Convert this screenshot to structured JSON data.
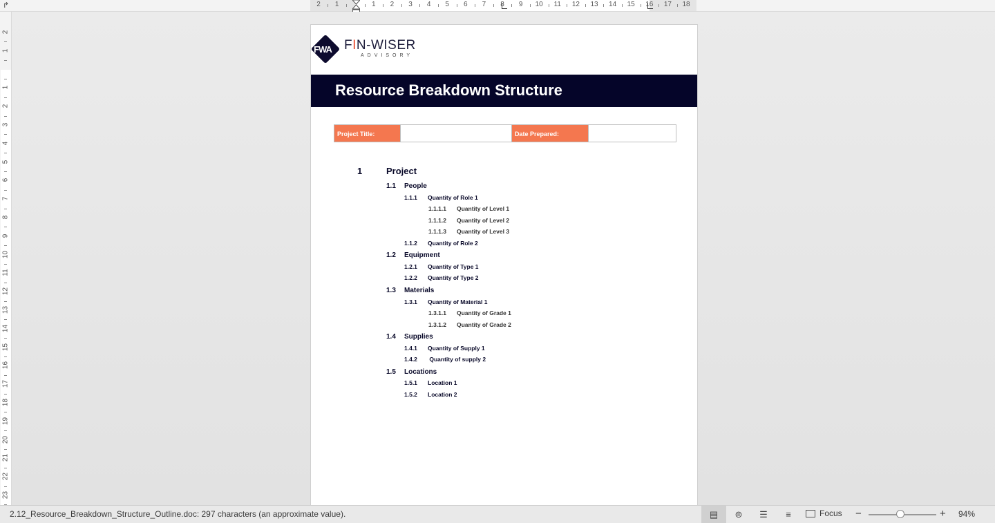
{
  "ruler": {
    "numbers": [
      "2",
      "1",
      "",
      "1",
      "2",
      "3",
      "4",
      "5",
      "6",
      "7",
      "8",
      "9",
      "10",
      "11",
      "12",
      "13",
      "14",
      "15",
      "16",
      "17",
      "18"
    ],
    "vertical_numbers": [
      "2",
      "1",
      "",
      "1",
      "2",
      "3",
      "4",
      "5",
      "6",
      "7",
      "8",
      "9",
      "10",
      "11",
      "12",
      "13",
      "14",
      "15",
      "16",
      "17",
      "18",
      "19",
      "20",
      "21",
      "22",
      "23"
    ]
  },
  "document": {
    "logo": {
      "brand_prefix": "F",
      "brand_accent": "I",
      "brand_rest": "N-WISER",
      "sub": "ADVISORY",
      "mark": "FWA"
    },
    "title": "Resource Breakdown Structure",
    "info": {
      "project_title_label": "Project Title:",
      "date_label": "Date Prepared:"
    },
    "outline": [
      {
        "level": 1,
        "num": "1",
        "text": "Project"
      },
      {
        "level": 2,
        "num": "1.1",
        "text": "People"
      },
      {
        "level": 3,
        "num": "1.1.1",
        "text": "Quantity of Role 1"
      },
      {
        "level": 4,
        "num": "1.1.1.1",
        "text": "Quantity of Level 1"
      },
      {
        "level": 4,
        "num": "1.1.1.2",
        "text": "Quantity of Level 2"
      },
      {
        "level": 4,
        "num": "1.1.1.3",
        "text": "Quantity of Level 3"
      },
      {
        "level": 3,
        "num": "1.1.2",
        "text": "Quantity of Role 2"
      },
      {
        "level": 2,
        "num": "1.2",
        "text": "Equipment"
      },
      {
        "level": 3,
        "num": "1.2.1",
        "text": "Quantity of Type 1"
      },
      {
        "level": 3,
        "num": "1.2.2",
        "text": "Quantity of Type 2"
      },
      {
        "level": 2,
        "num": "1.3",
        "text": "Materials"
      },
      {
        "level": 3,
        "num": "1.3.1",
        "text": "Quantity of Material 1"
      },
      {
        "level": 4,
        "num": "1.3.1.1",
        "text": "Quantity of Grade 1"
      },
      {
        "level": 4,
        "num": "1.3.1.2",
        "text": "Quantity of Grade 2"
      },
      {
        "level": 2,
        "num": "1.4",
        "text": "Supplies"
      },
      {
        "level": 3,
        "num": "1.4.1",
        "text": "Quantity of Supply 1"
      },
      {
        "level": 3,
        "num": "1.4.2",
        "text": " Quantity of supply 2"
      },
      {
        "level": 2,
        "num": "1.5",
        "text": "Locations"
      },
      {
        "level": 3,
        "num": "1.5.1",
        "text": "Location 1"
      },
      {
        "level": 3,
        "num": "1.5.2",
        "text": "Location 2"
      }
    ]
  },
  "statusbar": {
    "info": "2.12_Resource_Breakdown_Structure_Outline.doc: 297 characters (an approximate value).",
    "focus_label": "Focus",
    "zoom_minus": "−",
    "zoom_plus": "+",
    "zoom": "94%",
    "zoom_fraction": 0.47,
    "views": [
      "print-layout-icon",
      "web-layout-icon",
      "outline-view-icon",
      "draft-view-icon"
    ]
  },
  "colors": {
    "banner": "#050529",
    "label_fill": "#f4774f",
    "accent": "#e94b2e"
  }
}
